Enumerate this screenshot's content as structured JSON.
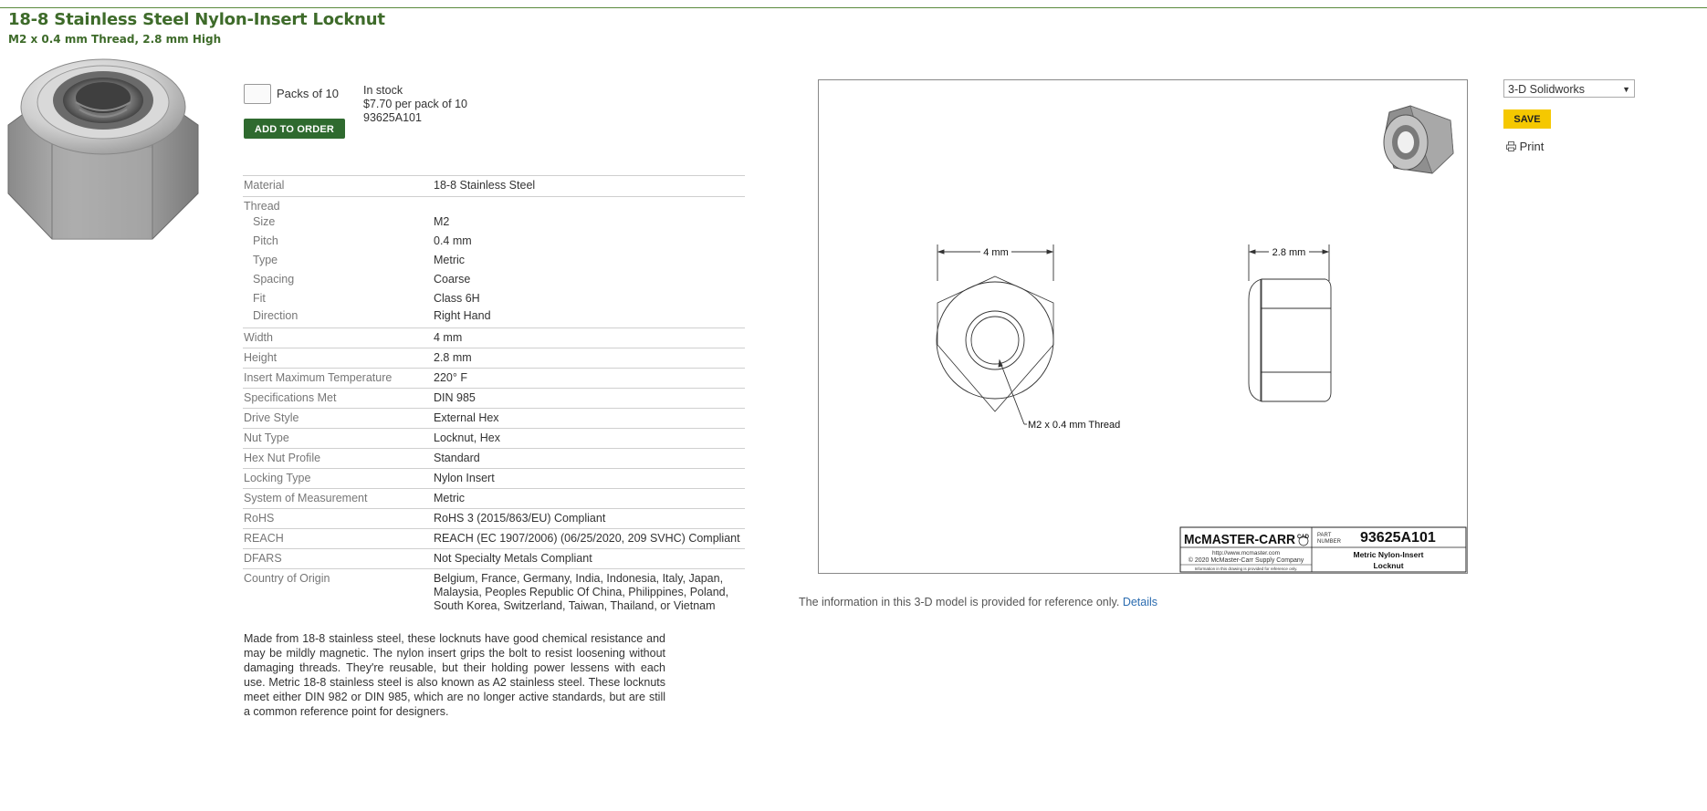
{
  "product": {
    "title": "18-8 Stainless Steel Nylon-Insert Locknut",
    "subtitle": "M2 x 0.4 mm Thread, 2.8 mm High",
    "image_icon": "hex-locknut-image"
  },
  "order": {
    "quantity_value": "",
    "unit_label": "Packs of 10",
    "add_button": "ADD TO ORDER",
    "stock_status": "In stock",
    "price": "$7.70 per pack of 10",
    "part_number": "93625A101"
  },
  "specs": [
    {
      "key": "Material",
      "value": "18-8 Stainless Steel"
    },
    {
      "key": "Thread",
      "value": ""
    },
    {
      "key": "Size",
      "value": "M2",
      "sub": true
    },
    {
      "key": "Pitch",
      "value": "0.4 mm",
      "sub": true
    },
    {
      "key": "Type",
      "value": "Metric",
      "sub": true
    },
    {
      "key": "Spacing",
      "value": "Coarse",
      "sub": true
    },
    {
      "key": "Fit",
      "value": "Class 6H",
      "sub": true
    },
    {
      "key": "Direction",
      "value": "Right Hand",
      "sub": true
    },
    {
      "key": "Width",
      "value": "4 mm"
    },
    {
      "key": "Height",
      "value": "2.8 mm"
    },
    {
      "key": "Insert Maximum Temperature",
      "value": "220° F"
    },
    {
      "key": "Specifications Met",
      "value": "DIN 985"
    },
    {
      "key": "Drive Style",
      "value": "External Hex"
    },
    {
      "key": "Nut Type",
      "value": "Locknut, Hex"
    },
    {
      "key": "Hex Nut Profile",
      "value": "Standard"
    },
    {
      "key": "Locking Type",
      "value": "Nylon Insert"
    },
    {
      "key": "System of Measurement",
      "value": "Metric"
    },
    {
      "key": "RoHS",
      "value": "RoHS 3 (2015/863/EU) Compliant"
    },
    {
      "key": "REACH",
      "value": "REACH (EC 1907/2006) (06/25/2020, 209 SVHC) Compliant"
    },
    {
      "key": "DFARS",
      "value": "Not Specialty Metals Compliant"
    },
    {
      "key": "Country of Origin",
      "value": "Belgium, France, Germany, India, Indonesia, Italy, Japan, Malaysia, Peoples Republic Of China, Philippines, Poland, South Korea, Switzerland, Taiwan, Thailand, or Vietnam"
    }
  ],
  "description": "Made from 18-8 stainless steel, these locknuts have good chemical resistance and may be mildly magnetic. The nylon insert grips the bolt to resist loosening without damaging threads. They're reusable, but their holding power lessens with each use. Metric 18-8 stainless steel is also known as A2 stainless steel. These locknuts meet either DIN 982 or DIN 985, which are no longer active standards, but are still a common reference point for designers.",
  "drawing": {
    "width_label": "4 mm",
    "height_label": "2.8 mm",
    "thread_label": "M2 x 0.4 mm Thread",
    "brand": "McMASTER-CARR",
    "cad_mark": "CAD",
    "website": "http://www.mcmaster.com",
    "copyright": "© 2020 McMaster-Carr Supply Company",
    "disclaimer": "Information in this drawing is provided for reference only.",
    "part_label_1": "PART",
    "part_label_2": "NUMBER",
    "part_number": "93625A101",
    "part_desc_1": "Metric Nylon-Insert",
    "part_desc_2": "Locknut"
  },
  "info": {
    "text": "The information in this 3-D model is provided for reference only.",
    "link": "Details"
  },
  "tools": {
    "format_selected": "3-D Solidworks",
    "save": "SAVE",
    "print": "Print",
    "print_icon": "printer-icon"
  },
  "colors": {
    "title_green": "#3e6b2a",
    "button_green": "#2f6a2f",
    "save_yellow": "#f5c800",
    "link_blue": "#2b6cb0"
  }
}
